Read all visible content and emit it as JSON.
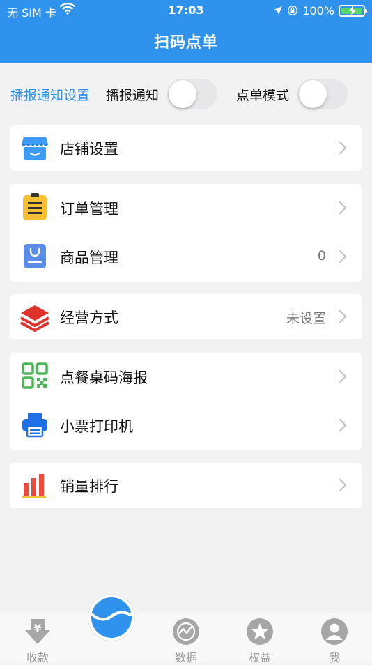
{
  "status_bar": {
    "carrier": "无 SIM 卡",
    "time": "17:03",
    "battery": "100%"
  },
  "header": {
    "title": "扫码点单"
  },
  "broadcast": {
    "settings_link": "播报通知设置",
    "notify_label": "播报通知",
    "notify_on": false,
    "order_mode_label": "点单模式",
    "order_mode_on": false
  },
  "menu": {
    "store_settings": {
      "label": "店铺设置",
      "icon": "store-icon"
    },
    "order_management": {
      "label": "订单管理",
      "icon": "clipboard-icon"
    },
    "product_management": {
      "label": "商品管理",
      "value": "0",
      "icon": "shopping-bag-icon"
    },
    "business_mode": {
      "label": "经营方式",
      "value": "未设置",
      "icon": "layers-icon"
    },
    "table_qr_poster": {
      "label": "点餐桌码海报",
      "icon": "qr-code-icon"
    },
    "receipt_printer": {
      "label": "小票打印机",
      "icon": "printer-icon"
    },
    "sales_ranking": {
      "label": "销量排行",
      "icon": "bar-chart-icon"
    }
  },
  "tabbar": {
    "collect": "收款",
    "data": "数据",
    "benefits": "权益",
    "me": "我"
  },
  "colors": {
    "primary": "#2f93ee",
    "background": "#f2f2f2",
    "value_gray": "#777777",
    "tab_gray": "#999999"
  }
}
